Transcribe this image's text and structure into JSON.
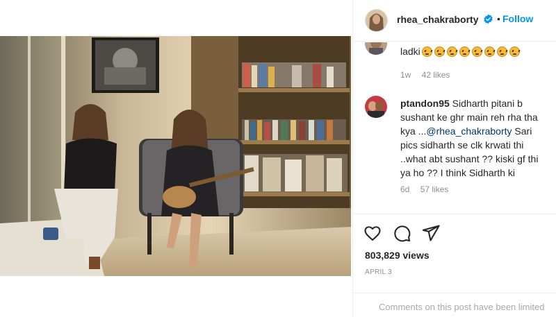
{
  "header": {
    "username": "rhea_chakraborty",
    "separator": "•",
    "follow_label": "Follow",
    "accent_color": "#0095f6",
    "verified_icon": "verified-badge-icon"
  },
  "comments": [
    {
      "text": "ladki",
      "emoji_name": "angry-face",
      "emoji_count": 8,
      "time": "1w",
      "likes": "42 likes"
    },
    {
      "username": "ptandon95",
      "text_before_mention": " Sidharth pitani b sushant ke ghr main reh rha tha kya ...",
      "mention": "@rhea_chakraborty",
      "text_after_mention": " Sari pics sidharth se clk krwati thi ..what abt sushant ?? kiski gf thi ya ho ?? I think Sidharth ki",
      "time": "6d",
      "likes": "57 likes"
    }
  ],
  "actions": {
    "like_icon": "heart-icon",
    "comment_icon": "comment-bubble-icon",
    "share_icon": "paper-plane-icon",
    "views": "803,829 views",
    "date": "APRIL 3"
  },
  "footer": {
    "comments_limited": "Comments on this post have been limited"
  }
}
